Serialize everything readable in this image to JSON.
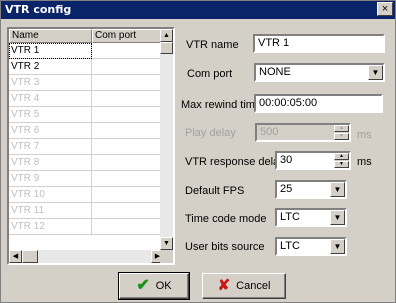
{
  "window": {
    "title": "VTR config",
    "close_glyph": "×"
  },
  "list": {
    "columns": [
      "Name",
      "Com port"
    ],
    "rows": [
      {
        "name": "VTR 1",
        "port": ""
      },
      {
        "name": "VTR 2",
        "port": ""
      },
      {
        "name": "VTR 3",
        "port": ""
      },
      {
        "name": "VTR 4",
        "port": ""
      },
      {
        "name": "VTR 5",
        "port": ""
      },
      {
        "name": "VTR 6",
        "port": ""
      },
      {
        "name": "VTR 7",
        "port": ""
      },
      {
        "name": "VTR 8",
        "port": ""
      },
      {
        "name": "VTR 9",
        "port": ""
      },
      {
        "name": "VTR 10",
        "port": ""
      },
      {
        "name": "VTR 11",
        "port": ""
      },
      {
        "name": "VTR 12",
        "port": ""
      }
    ]
  },
  "form": {
    "vtr_name": {
      "label": "VTR name",
      "value": "VTR 1"
    },
    "com_port": {
      "label": "Com port",
      "value": "NONE"
    },
    "max_rewind": {
      "label": "Max rewind time",
      "value": "00:00:05:00"
    },
    "play_delay": {
      "label": "Play delay",
      "value": "500",
      "unit": "ms"
    },
    "response_delay": {
      "label": "VTR response delay",
      "value": "30",
      "unit": "ms"
    },
    "default_fps": {
      "label": "Default FPS",
      "value": "25"
    },
    "time_code_mode": {
      "label": "Time code mode",
      "value": "LTC"
    },
    "user_bits_source": {
      "label": "User bits source",
      "value": "LTC"
    }
  },
  "buttons": {
    "ok": "OK",
    "cancel": "Cancel"
  }
}
